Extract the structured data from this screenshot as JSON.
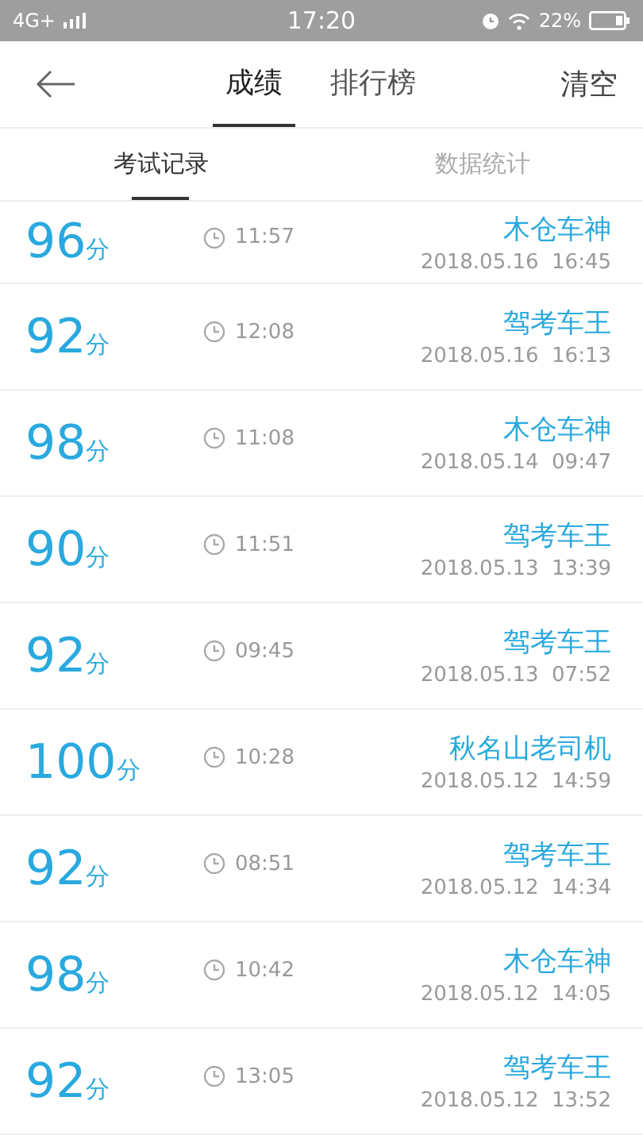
{
  "status_bar": {
    "network": "4G+",
    "time": "17:20",
    "battery": "22%"
  },
  "header": {
    "tabs": [
      {
        "label": "成绩",
        "selected": true
      },
      {
        "label": "排行榜",
        "selected": false
      }
    ],
    "action": "清空"
  },
  "sub_tabs": [
    {
      "label": "考试记录",
      "selected": true
    },
    {
      "label": "数据统计",
      "selected": false
    }
  ],
  "records": [
    {
      "score": "96",
      "unit": "分",
      "duration": "11:57",
      "title": "木仓车神",
      "date": "2018.05.16  16:45"
    },
    {
      "score": "92",
      "unit": "分",
      "duration": "12:08",
      "title": "驾考车王",
      "date": "2018.05.16  16:13"
    },
    {
      "score": "98",
      "unit": "分",
      "duration": "11:08",
      "title": "木仓车神",
      "date": "2018.05.14  09:47"
    },
    {
      "score": "90",
      "unit": "分",
      "duration": "11:51",
      "title": "驾考车王",
      "date": "2018.05.13  13:39"
    },
    {
      "score": "92",
      "unit": "分",
      "duration": "09:45",
      "title": "驾考车王",
      "date": "2018.05.13  07:52"
    },
    {
      "score": "100",
      "unit": "分",
      "duration": "10:28",
      "title": "秋名山老司机",
      "date": "2018.05.12  14:59"
    },
    {
      "score": "92",
      "unit": "分",
      "duration": "08:51",
      "title": "驾考车王",
      "date": "2018.05.12  14:34"
    },
    {
      "score": "98",
      "unit": "分",
      "duration": "10:42",
      "title": "木仓车神",
      "date": "2018.05.12  14:05"
    },
    {
      "score": "92",
      "unit": "分",
      "duration": "13:05",
      "title": "驾考车王",
      "date": "2018.05.12  13:52"
    }
  ]
}
